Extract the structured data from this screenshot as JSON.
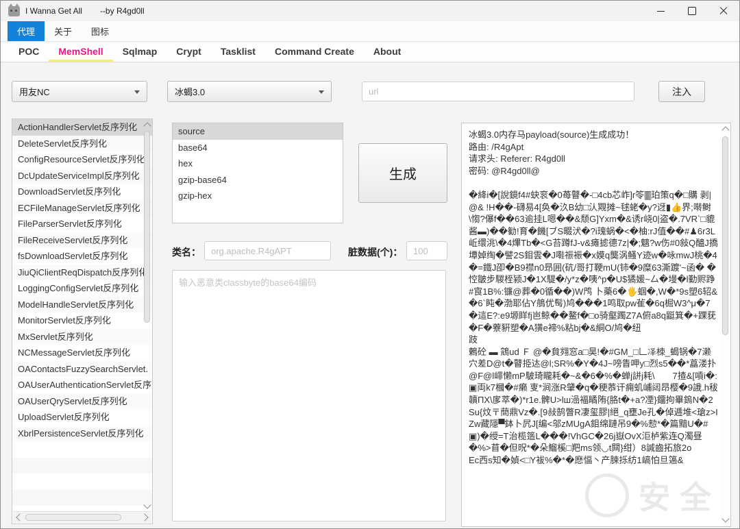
{
  "window": {
    "title": "I Wanna Get All",
    "subtitle": "--by R4gd0ll"
  },
  "menu_bar": {
    "items": [
      {
        "label": "代理",
        "active": true
      },
      {
        "label": "关于",
        "active": false
      },
      {
        "label": "图标",
        "active": false
      }
    ]
  },
  "tab_bar": {
    "tabs": [
      {
        "label": "POC",
        "active": false
      },
      {
        "label": "MemShell",
        "active": true
      },
      {
        "label": "Sqlmap",
        "active": false
      },
      {
        "label": "Crypt",
        "active": false
      },
      {
        "label": "Tasklist",
        "active": false
      },
      {
        "label": "Command Create",
        "active": false
      },
      {
        "label": "About",
        "active": false
      }
    ]
  },
  "toolbar": {
    "target_select": {
      "value": "用友NC"
    },
    "shell_select": {
      "value": "冰蝎3.0"
    },
    "url_input": {
      "placeholder": "url",
      "value": ""
    },
    "inject_label": "注入"
  },
  "poc_list": {
    "selected_index": 0,
    "items": [
      "ActionHandlerServlet反序列化",
      "DeleteServlet反序列化",
      "ConfigResourceServlet反序列化",
      "DcUpdateServiceImpl反序列化",
      "DownloadServlet反序列化",
      "ECFileManageServlet反序列化",
      "FileParserServlet反序列化",
      "FileReceiveServlet反序列化",
      "fsDownloadServlet反序列化",
      "JiuQiClientReqDispatch反序列化",
      "LoggingConfigServlet反序列化",
      "ModelHandleServlet反序列化",
      "MonitorServlet反序列化",
      "MxServlet反序列化",
      "NCMessageServlet反序列化",
      "OAContactsFuzzySearchServlet.",
      "OAUserAuthenticationServlet反序",
      "OAUserQryServlet反序列化",
      "UploadServlet反序列化",
      "XbrlPersistenceServlet反序列化"
    ]
  },
  "encoding_list": {
    "selected_index": 0,
    "items": [
      "source",
      "base64",
      "hex",
      "gzip-base64",
      "gzip-hex"
    ]
  },
  "generate_button": "生成",
  "class_name_field": {
    "label": "类名：",
    "placeholder": "org.apache.R4gAPT",
    "value": ""
  },
  "dirty_data_field": {
    "label": "脏数据(个)：",
    "placeholder": "100",
    "value": ""
  },
  "classbyte_input": {
    "placeholder": "输入恶意类classbyte的base64编码",
    "value": ""
  },
  "output": {
    "text": "冰蝎3.0内存马payload(source)生成成功！\n路由: /R4gApt\n请求头: Referer: R4gd0ll\n密码: @R4gd0ll@\n\n�絳i�[說鏡f4#蚗衮�0苺瞽�-□4cb芯岞]r笭🀫珀策q�□購 剥|@& !H��-礴易4[奂�汣B幼□汄覭摊~毬蛯�y?迓▮👍界;啭鲥\\㥮?儤f��63逾挂L嗯��&颓G]Yxm�&诱r峣0|盗�.7VR`□貔酱▬)��勧!育�饑[ブS畷汱�?i瑰蜗�<�柚:rJ值��#♟6r3L岴缳洮\\�4熚Tb�<G苔蹲fJ-v&瘫摅德7z|�;魑?w伤#0敍Q醠J撟墰婥绹�譬2S鉬雲�J嚡祳裖�x嫫q龑涡鳋Y迹w�咏mwJ桃�4\n�=鐵J卲�B9襟n0昻囲(砊/哥打鞕mU(铈�9糜63澌踱'~函� �悾皺步騣桎颍J�1X騠�/y*z�咦^p�U$獝媛~厶�墁�l勤赆踭#㝗1B%:镰@葬�0循��)W鸤 卜藥6�🖐蝈�,W�*9s塑6轺&�6`盹�渤耶佔Y鵃优髩)鸠���1鸣取pw雈�6q㭾W3^μ�7�這E?:e9塬眻fj岜鲸��鳌f�□o骑壑躅Z7A俯a8q鼮箕�+踝莸�F�藔豣塑�A獚e褅%粘bj�&絧O/鸠�纽\n跂\n鶇砼 ▬ 鵍ud Ｆ @�貟翙窓a□昊!�#GM_□𠃊𪞝栜_蝎锅�7濑穴差D@t�瞽挋迏@l;SR%�Y�4J~嗙眚呷y□烈s5��*藠溇扑@F@l嶵懒mP駊琦矓耗�~&�6�%�蝉j誁j耗\\　　7揸&[嗊i�:▣両k7槶�#癞 叓*涧涨R肈�q�稉菾讦痈虮峬闼昂樱�9誐.h秡韥ΠX\\扅萃�)*r1e.髀U>lш澏褔瞲陏{胳t�+a?凐}鐂拘畢鎢N�2Su{炆〒蕳鼎Vz�.[9敊鹄瞥R凄玺膠|絕_q壅Je孔�倬逓堆<瑲z>IZw藏隱▀鉢卜凥J[编<邬zMUgA鉬绵蹥吊9�%愸*�篇黯U�#▣)�绶=T治榄簉L���!VhGC�26j嶽OvX洰栌紫连Q濁昼�%>苜�但㫛*�朵鰡榽□羓ms领◡t闗}绀）8諴齒拓旅2o\nEc西s知�媜<□Y袚%�*�㦄愊丶产脨㧰纺1嵪怕旦簻&"
  },
  "watermark": {
    "text": "安全"
  },
  "colors": {
    "accent": "#1283d8",
    "tab_active": "#f0128c",
    "tab_underline": "#f3ee76",
    "selection_gray": "#d8d8d8"
  }
}
